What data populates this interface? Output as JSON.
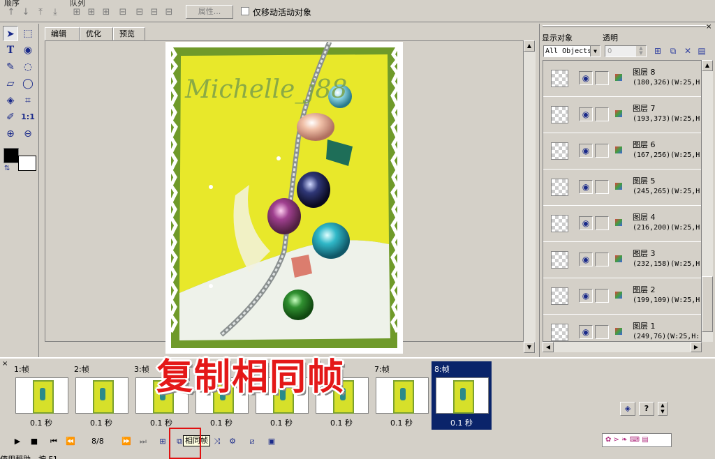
{
  "toolbar": {
    "order_label": "顺序",
    "queue_label": "队列",
    "properties_label": "属性...",
    "only_move_label": "仅移动活动对象"
  },
  "tabs": [
    "编辑",
    "优化",
    "预览"
  ],
  "artwork": {
    "watermark": "Michelle_j88"
  },
  "right_panel": {
    "show_objects_label": "显示对象",
    "opacity_label": "透明",
    "select_value": "All Objects",
    "opacity_value": "0",
    "layers": [
      {
        "name": "图层 8",
        "info": "(180,326)(W:25,H"
      },
      {
        "name": "图层 7",
        "info": "(193,373)(W:25,H"
      },
      {
        "name": "图层 6",
        "info": "(167,256)(W:25,H"
      },
      {
        "name": "图层 5",
        "info": "(245,265)(W:25,H"
      },
      {
        "name": "图层 4",
        "info": "(216,200)(W:25,H"
      },
      {
        "name": "图层 3",
        "info": "(232,158)(W:25,H"
      },
      {
        "name": "图层 2",
        "info": "(199,109)(W:25,H"
      },
      {
        "name": "图层 1",
        "info": "(249,76)(W:25,H:"
      }
    ]
  },
  "timeline": {
    "frames": [
      {
        "label": "1:帧",
        "delay": "0.1 秒"
      },
      {
        "label": "2:帧",
        "delay": "0.1 秒"
      },
      {
        "label": "3:帧",
        "delay": "0.1 秒"
      },
      {
        "label": "4:帧",
        "delay": "0.1 秒"
      },
      {
        "label": "5:帧",
        "delay": "0.1 秒"
      },
      {
        "label": "6:帧",
        "delay": "0.1 秒"
      },
      {
        "label": "7:帧",
        "delay": "0.1 秒"
      },
      {
        "label": "8:帧",
        "delay": "0.1 秒"
      }
    ],
    "selected_index": 7,
    "frame_counter": "8/8",
    "tooltip": "相同帧",
    "overlay_caption": "复制相同帧"
  },
  "status_bar": {
    "text": "使用帮助，按 F1"
  },
  "colors": {
    "selection": "#0a246a",
    "caption_red": "#e41818",
    "artwork_yellow": "#e8e82a",
    "border_green": "#6f9a2a"
  }
}
